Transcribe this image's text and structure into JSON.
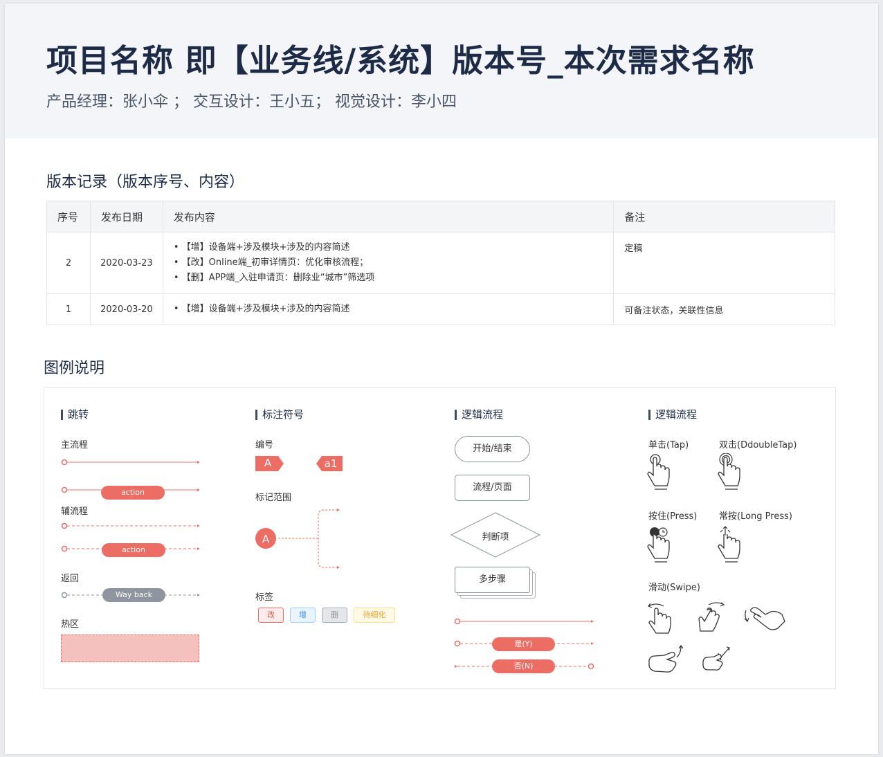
{
  "header": {
    "title": "项目名称 即【业务线/系统】版本号_本次需求名称",
    "subtitle": "产品经理：张小伞 ；  交互设计：王小五；  视觉设计：李小四"
  },
  "version_section": {
    "title": "版本记录（版本序号、内容）",
    "columns": [
      "序号",
      "发布日期",
      "发布内容",
      "备注"
    ],
    "rows": [
      {
        "no": "2",
        "date": "2020-03-23",
        "contents": [
          "【增】设备端+涉及模块+涉及的内容简述",
          "【改】Online端_初审详情页：优化审核流程；",
          "【删】APP端_入驻申请页：删除业“城市”筛选项"
        ],
        "note": "定稿"
      },
      {
        "no": "1",
        "date": "2020-03-20",
        "contents": [
          "【增】设备端+涉及模块+涉及的内容简述"
        ],
        "note": "可备注状态，关联性信息"
      }
    ]
  },
  "legend_section": {
    "title": "图例说明",
    "jump": {
      "title": "跳转",
      "main_flow": "主流程",
      "action_label": "action",
      "aux_flow": "辅流程",
      "aux_action_label": "action",
      "back": "返回",
      "back_label": "Way back",
      "hotspot": "热区"
    },
    "marks": {
      "title": "标注符号",
      "numbering": "编号",
      "badge_a": "A",
      "badge_a1": "a1",
      "range": "标记范围",
      "range_badge": "A",
      "tags_title": "标签",
      "tags": [
        "改",
        "增",
        "删",
        "待细化"
      ]
    },
    "logic": {
      "title": "逻辑流程",
      "start_end": "开始/结束",
      "process_page": "流程/页面",
      "decision": "判断项",
      "multi_step": "多步骤",
      "yes": "是(Y)",
      "no": "否(N)"
    },
    "gestures": {
      "title": "逻辑流程",
      "tap": "单击(Tap)",
      "double_tap": "双击(DdoubleTap)",
      "press": "按住(Press)",
      "long_press": "常按(Long Press)",
      "swipe": "滑动(Swipe)"
    }
  },
  "colors": {
    "accent_red": "#ec6d64",
    "grey_pill": "#8e959e",
    "title_navy": "#1d2b46",
    "hero_bg": "#f3f5f8",
    "hotspot_fill": "#f4c1be"
  }
}
